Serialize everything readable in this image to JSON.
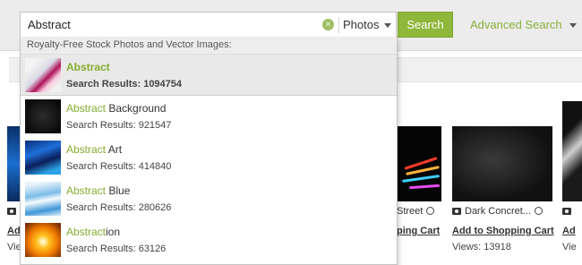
{
  "search": {
    "query": "Abstract",
    "clear_icon": "clear-circle-icon",
    "type_select": "Photos",
    "button_label": "Search",
    "advanced_label": "Advanced Search"
  },
  "dropdown": {
    "header": "Royalty-Free Stock Photos and Vector Images:",
    "suggestions": [
      {
        "prefix": "Abstract",
        "rest": "",
        "count": "Search Results: 1094754",
        "active": true
      },
      {
        "prefix": "Abstract",
        "rest": " Background",
        "count": "Search Results: 921547",
        "active": false
      },
      {
        "prefix": "Abstract",
        "rest": " Art",
        "count": "Search Results: 414840",
        "active": false
      },
      {
        "prefix": "Abstract",
        "rest": " Blue",
        "count": "Search Results: 280626",
        "active": false
      },
      {
        "prefix": "Abstract",
        "rest": "ion",
        "count": "Search Results: 63126",
        "active": false
      }
    ]
  },
  "results": {
    "left_card": {
      "caption": "",
      "cart_label": "Add",
      "views": "View"
    },
    "street_card": {
      "caption": "Street",
      "cart_label": "ping Cart"
    },
    "concrete_card": {
      "caption": "Dark Concret...",
      "cart_label": "Add to Shopping Cart",
      "views": "Views: 13918"
    },
    "right_card": {
      "caption": "",
      "cart_label": "Ad",
      "views": "Vie"
    }
  },
  "colors": {
    "accent_green": "#8fb83b",
    "highlight_green": "#86ad2f"
  }
}
